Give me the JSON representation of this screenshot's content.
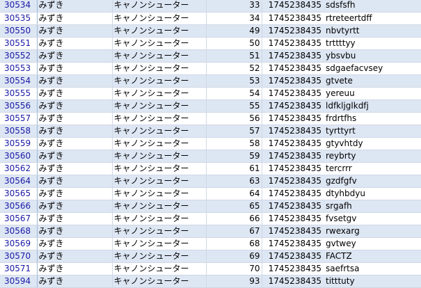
{
  "rows": [
    {
      "id": "30534",
      "name": "みずき",
      "type": "キャノンシューター",
      "num": "33",
      "ts": "1745238435",
      "str": "sdsfsfh"
    },
    {
      "id": "30535",
      "name": "みずき",
      "type": "キャノンシューター",
      "num": "34",
      "ts": "1745238435",
      "str": "rtreteertdff"
    },
    {
      "id": "30550",
      "name": "みずき",
      "type": "キャノンシューター",
      "num": "49",
      "ts": "1745238435",
      "str": "nbvtyrtt"
    },
    {
      "id": "30551",
      "name": "みずき",
      "type": "キャノンシューター",
      "num": "50",
      "ts": "1745238435",
      "str": "trttttyy"
    },
    {
      "id": "30552",
      "name": "みずき",
      "type": "キャノンシューター",
      "num": "51",
      "ts": "1745238435",
      "str": "ybsvbu"
    },
    {
      "id": "30553",
      "name": "みずき",
      "type": "キャノンシューター",
      "num": "52",
      "ts": "1745238435",
      "str": "sdgaefacvsey"
    },
    {
      "id": "30554",
      "name": "みずき",
      "type": "キャノンシューター",
      "num": "53",
      "ts": "1745238435",
      "str": "gtvete"
    },
    {
      "id": "30555",
      "name": "みずき",
      "type": "キャノンシューター",
      "num": "54",
      "ts": "1745238435",
      "str": "yereuu"
    },
    {
      "id": "30556",
      "name": "みずき",
      "type": "キャノンシューター",
      "num": "55",
      "ts": "1745238435",
      "str": "ldfkljglkdfj"
    },
    {
      "id": "30557",
      "name": "みずき",
      "type": "キャノンシューター",
      "num": "56",
      "ts": "1745238435",
      "str": "frdrtfhs"
    },
    {
      "id": "30558",
      "name": "みずき",
      "type": "キャノンシューター",
      "num": "57",
      "ts": "1745238435",
      "str": "tyrttyrt"
    },
    {
      "id": "30559",
      "name": "みずき",
      "type": "キャノンシューター",
      "num": "58",
      "ts": "1745238435",
      "str": "gtyvhtdy"
    },
    {
      "id": "30560",
      "name": "みずき",
      "type": "キャノンシューター",
      "num": "59",
      "ts": "1745238435",
      "str": "reybrty"
    },
    {
      "id": "30562",
      "name": "みずき",
      "type": "キャノンシューター",
      "num": "61",
      "ts": "1745238435",
      "str": "tercrrr"
    },
    {
      "id": "30564",
      "name": "みずき",
      "type": "キャノンシューター",
      "num": "63",
      "ts": "1745238435",
      "str": "gzdfgfv"
    },
    {
      "id": "30565",
      "name": "みずき",
      "type": "キャノンシューター",
      "num": "64",
      "ts": "1745238435",
      "str": "dtyhbdyu"
    },
    {
      "id": "30566",
      "name": "みずき",
      "type": "キャノンシューター",
      "num": "65",
      "ts": "1745238435",
      "str": "srgafh"
    },
    {
      "id": "30567",
      "name": "みずき",
      "type": "キャノンシューター",
      "num": "66",
      "ts": "1745238435",
      "str": "fvsetgv"
    },
    {
      "id": "30568",
      "name": "みずき",
      "type": "キャノンシューター",
      "num": "67",
      "ts": "1745238435",
      "str": "rwexarg"
    },
    {
      "id": "30569",
      "name": "みずき",
      "type": "キャノンシューター",
      "num": "68",
      "ts": "1745238435",
      "str": "gvtwey"
    },
    {
      "id": "30570",
      "name": "みずき",
      "type": "キャノンシューター",
      "num": "69",
      "ts": "1745238435",
      "str": "FACTZ"
    },
    {
      "id": "30571",
      "name": "みずき",
      "type": "キャノンシューター",
      "num": "70",
      "ts": "1745238435",
      "str": "saefrtsa"
    },
    {
      "id": "30594",
      "name": "みずき",
      "type": "キャノンシューター",
      "num": "93",
      "ts": "1745238435",
      "str": "titttuty"
    }
  ],
  "colors": {
    "stripe": "#dde6f3",
    "id_text": "#1a1aa6",
    "gridline": "#d0d7e5"
  }
}
